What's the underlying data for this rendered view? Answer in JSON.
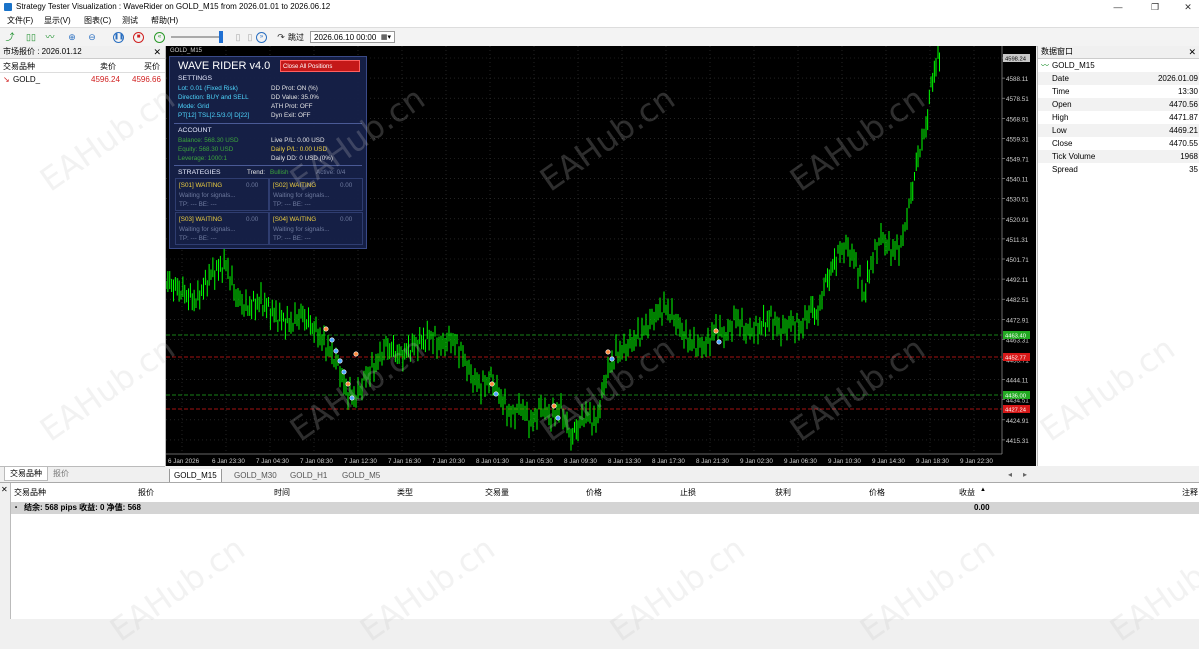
{
  "window": {
    "title": "Strategy Tester Visualization : WaveRider on GOLD_M15 from 2026.01.01 to 2026.06.12",
    "buttons": [
      "—",
      "❐",
      "✕"
    ]
  },
  "menu": [
    "文件(F)",
    "显示(V)",
    "图表(C)",
    "测试",
    "帮助(H)"
  ],
  "toolbar": {
    "skip_label": "跳过",
    "date_value": "2026.06.10 00:00"
  },
  "market_watch": {
    "title": "市场报价 : 2026.01.12",
    "columns": [
      "交易品种",
      "卖价",
      "买价"
    ],
    "rows": [
      {
        "symbol": "GOLD_",
        "bid": "4596.24",
        "ask": "4596.66"
      }
    ],
    "tabs": [
      "交易品种",
      "报价"
    ]
  },
  "chart": {
    "header": "GOLD_M15",
    "price_labels": [
      "4598.24",
      "4588.11",
      "4578.51",
      "4568.91",
      "4559.31",
      "4549.71",
      "4540.11",
      "4530.51",
      "4520.91",
      "4511.31",
      "4501.71",
      "4492.11",
      "4482.51",
      "4472.91",
      "4463.31",
      "4453.71",
      "4444.11",
      "4434.51",
      "4424.91",
      "4415.31"
    ],
    "level_tags": [
      {
        "text": "4598.24",
        "color": "#c8c8c8"
      },
      {
        "text": "4463.40",
        "color": "#22aa22"
      },
      {
        "text": "4452.77",
        "color": "#d81818"
      },
      {
        "text": "4436.00",
        "color": "#22aa22"
      },
      {
        "text": "4427.24",
        "color": "#d81818"
      }
    ],
    "time_labels": [
      "6 Jan 2026",
      "6 Jan 23:30",
      "7 Jan 04:30",
      "7 Jan 08:30",
      "7 Jan 12:30",
      "7 Jan 16:30",
      "7 Jan 20:30",
      "8 Jan 01:30",
      "8 Jan 05:30",
      "8 Jan 09:30",
      "8 Jan 13:30",
      "8 Jan 17:30",
      "8 Jan 21:30",
      "9 Jan 02:30",
      "9 Jan 06:30",
      "9 Jan 10:30",
      "9 Jan 14:30",
      "9 Jan 18:30",
      "9 Jan 22:30"
    ],
    "tabs": [
      "GOLD_M15",
      "GOLD_M30",
      "GOLD_H1",
      "GOLD_M5"
    ]
  },
  "ea": {
    "title": "WAVE RIDER v4.0",
    "close_all": "Close All Positions",
    "settings_title": "SETTINGS",
    "lot": "Lot: 0.01 (Fixed Risk)",
    "direction": "Direction: BUY and SELL",
    "mode": "Mode: Grid",
    "pt": "PT[12] TSL[2.5/3.0] D[22]",
    "dd_prot": "DD Prot: ON (%)",
    "dd_value": "DD Value: 35.0%",
    "ath_prot": "ATH Prot: OFF",
    "dyn_exit": "Dyn Exit: OFF",
    "account_title": "ACCOUNT",
    "balance": "Balance: 568.30 USD",
    "equity": "Equity: 568.30 USD",
    "leverage": "Leverage: 1000:1",
    "live_pl": "Live P/L: 0.00 USD",
    "daily_pl": "Daily P/L: 0.00 USD",
    "daily_dd": "Daily DD: 0 USD (0%)",
    "strategies_title": "STRATEGIES",
    "trend_label": "Trend:",
    "trend_value": "Bullish",
    "active": "Active: 0/4",
    "strategies": [
      {
        "name": "[S01] WAITING",
        "pl": "0.00",
        "msg": "Waiting for signals...",
        "tp": "TP: ---  BE: ---"
      },
      {
        "name": "[S02] WAITING",
        "pl": "0.00",
        "msg": "Waiting for signals...",
        "tp": "TP: ---  BE: ---"
      },
      {
        "name": "[S03] WAITING",
        "pl": "0.00",
        "msg": "Waiting for signals...",
        "tp": "TP: ---  BE: ---"
      },
      {
        "name": "[S04] WAITING",
        "pl": "0.00",
        "msg": "Waiting for signals...",
        "tp": "TP: ---  BE: ---"
      }
    ]
  },
  "data_window": {
    "title": "数据窗口",
    "symbol": "GOLD_M15",
    "rows": [
      {
        "label": "Date",
        "value": "2026.01.09"
      },
      {
        "label": "Time",
        "value": "13:30"
      },
      {
        "label": "Open",
        "value": "4470.56"
      },
      {
        "label": "High",
        "value": "4471.87"
      },
      {
        "label": "Low",
        "value": "4469.21"
      },
      {
        "label": "Close",
        "value": "4470.55"
      },
      {
        "label": "Tick Volume",
        "value": "1968"
      },
      {
        "label": "Spread",
        "value": "35"
      }
    ]
  },
  "terminal": {
    "columns": [
      "交易品种",
      "报价",
      "时间",
      "类型",
      "交易量",
      "价格",
      "止损",
      "获利",
      "价格",
      "收益",
      "注释"
    ],
    "summary": "结余: 568 pips  收益: 0  净值: 568",
    "summary_value": "0.00"
  },
  "watermark": "EAHub.cn",
  "colors": {
    "chart_bg": "#000000",
    "candle": "#00ff00",
    "grid": "#3a3a3a",
    "panel": "#162048",
    "accent_red": "#c41818"
  }
}
